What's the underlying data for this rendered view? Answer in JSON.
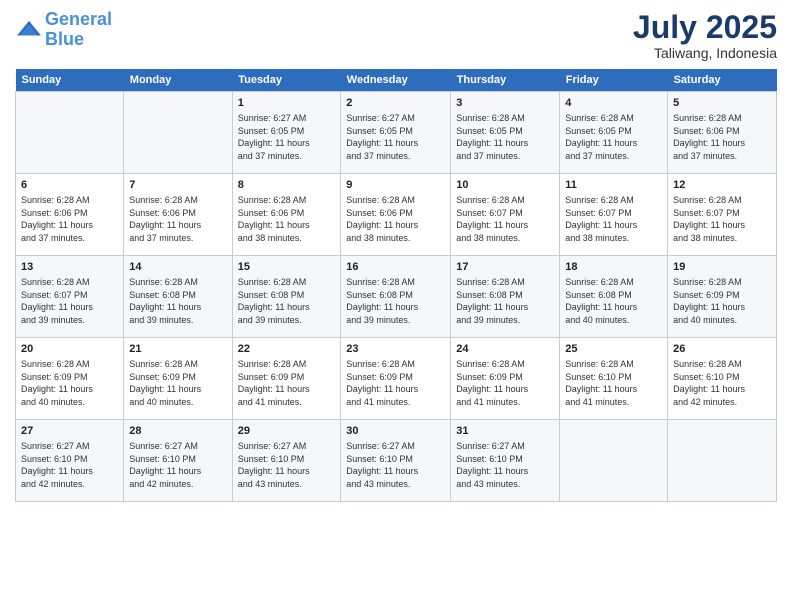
{
  "header": {
    "logo_line1": "General",
    "logo_line2": "Blue",
    "month": "July 2025",
    "location": "Taliwang, Indonesia"
  },
  "weekdays": [
    "Sunday",
    "Monday",
    "Tuesday",
    "Wednesday",
    "Thursday",
    "Friday",
    "Saturday"
  ],
  "weeks": [
    [
      {
        "day": "",
        "info": ""
      },
      {
        "day": "",
        "info": ""
      },
      {
        "day": "1",
        "info": "Sunrise: 6:27 AM\nSunset: 6:05 PM\nDaylight: 11 hours\nand 37 minutes."
      },
      {
        "day": "2",
        "info": "Sunrise: 6:27 AM\nSunset: 6:05 PM\nDaylight: 11 hours\nand 37 minutes."
      },
      {
        "day": "3",
        "info": "Sunrise: 6:28 AM\nSunset: 6:05 PM\nDaylight: 11 hours\nand 37 minutes."
      },
      {
        "day": "4",
        "info": "Sunrise: 6:28 AM\nSunset: 6:05 PM\nDaylight: 11 hours\nand 37 minutes."
      },
      {
        "day": "5",
        "info": "Sunrise: 6:28 AM\nSunset: 6:06 PM\nDaylight: 11 hours\nand 37 minutes."
      }
    ],
    [
      {
        "day": "6",
        "info": "Sunrise: 6:28 AM\nSunset: 6:06 PM\nDaylight: 11 hours\nand 37 minutes."
      },
      {
        "day": "7",
        "info": "Sunrise: 6:28 AM\nSunset: 6:06 PM\nDaylight: 11 hours\nand 37 minutes."
      },
      {
        "day": "8",
        "info": "Sunrise: 6:28 AM\nSunset: 6:06 PM\nDaylight: 11 hours\nand 38 minutes."
      },
      {
        "day": "9",
        "info": "Sunrise: 6:28 AM\nSunset: 6:06 PM\nDaylight: 11 hours\nand 38 minutes."
      },
      {
        "day": "10",
        "info": "Sunrise: 6:28 AM\nSunset: 6:07 PM\nDaylight: 11 hours\nand 38 minutes."
      },
      {
        "day": "11",
        "info": "Sunrise: 6:28 AM\nSunset: 6:07 PM\nDaylight: 11 hours\nand 38 minutes."
      },
      {
        "day": "12",
        "info": "Sunrise: 6:28 AM\nSunset: 6:07 PM\nDaylight: 11 hours\nand 38 minutes."
      }
    ],
    [
      {
        "day": "13",
        "info": "Sunrise: 6:28 AM\nSunset: 6:07 PM\nDaylight: 11 hours\nand 39 minutes."
      },
      {
        "day": "14",
        "info": "Sunrise: 6:28 AM\nSunset: 6:08 PM\nDaylight: 11 hours\nand 39 minutes."
      },
      {
        "day": "15",
        "info": "Sunrise: 6:28 AM\nSunset: 6:08 PM\nDaylight: 11 hours\nand 39 minutes."
      },
      {
        "day": "16",
        "info": "Sunrise: 6:28 AM\nSunset: 6:08 PM\nDaylight: 11 hours\nand 39 minutes."
      },
      {
        "day": "17",
        "info": "Sunrise: 6:28 AM\nSunset: 6:08 PM\nDaylight: 11 hours\nand 39 minutes."
      },
      {
        "day": "18",
        "info": "Sunrise: 6:28 AM\nSunset: 6:08 PM\nDaylight: 11 hours\nand 40 minutes."
      },
      {
        "day": "19",
        "info": "Sunrise: 6:28 AM\nSunset: 6:09 PM\nDaylight: 11 hours\nand 40 minutes."
      }
    ],
    [
      {
        "day": "20",
        "info": "Sunrise: 6:28 AM\nSunset: 6:09 PM\nDaylight: 11 hours\nand 40 minutes."
      },
      {
        "day": "21",
        "info": "Sunrise: 6:28 AM\nSunset: 6:09 PM\nDaylight: 11 hours\nand 40 minutes."
      },
      {
        "day": "22",
        "info": "Sunrise: 6:28 AM\nSunset: 6:09 PM\nDaylight: 11 hours\nand 41 minutes."
      },
      {
        "day": "23",
        "info": "Sunrise: 6:28 AM\nSunset: 6:09 PM\nDaylight: 11 hours\nand 41 minutes."
      },
      {
        "day": "24",
        "info": "Sunrise: 6:28 AM\nSunset: 6:09 PM\nDaylight: 11 hours\nand 41 minutes."
      },
      {
        "day": "25",
        "info": "Sunrise: 6:28 AM\nSunset: 6:10 PM\nDaylight: 11 hours\nand 41 minutes."
      },
      {
        "day": "26",
        "info": "Sunrise: 6:28 AM\nSunset: 6:10 PM\nDaylight: 11 hours\nand 42 minutes."
      }
    ],
    [
      {
        "day": "27",
        "info": "Sunrise: 6:27 AM\nSunset: 6:10 PM\nDaylight: 11 hours\nand 42 minutes."
      },
      {
        "day": "28",
        "info": "Sunrise: 6:27 AM\nSunset: 6:10 PM\nDaylight: 11 hours\nand 42 minutes."
      },
      {
        "day": "29",
        "info": "Sunrise: 6:27 AM\nSunset: 6:10 PM\nDaylight: 11 hours\nand 43 minutes."
      },
      {
        "day": "30",
        "info": "Sunrise: 6:27 AM\nSunset: 6:10 PM\nDaylight: 11 hours\nand 43 minutes."
      },
      {
        "day": "31",
        "info": "Sunrise: 6:27 AM\nSunset: 6:10 PM\nDaylight: 11 hours\nand 43 minutes."
      },
      {
        "day": "",
        "info": ""
      },
      {
        "day": "",
        "info": ""
      }
    ]
  ]
}
